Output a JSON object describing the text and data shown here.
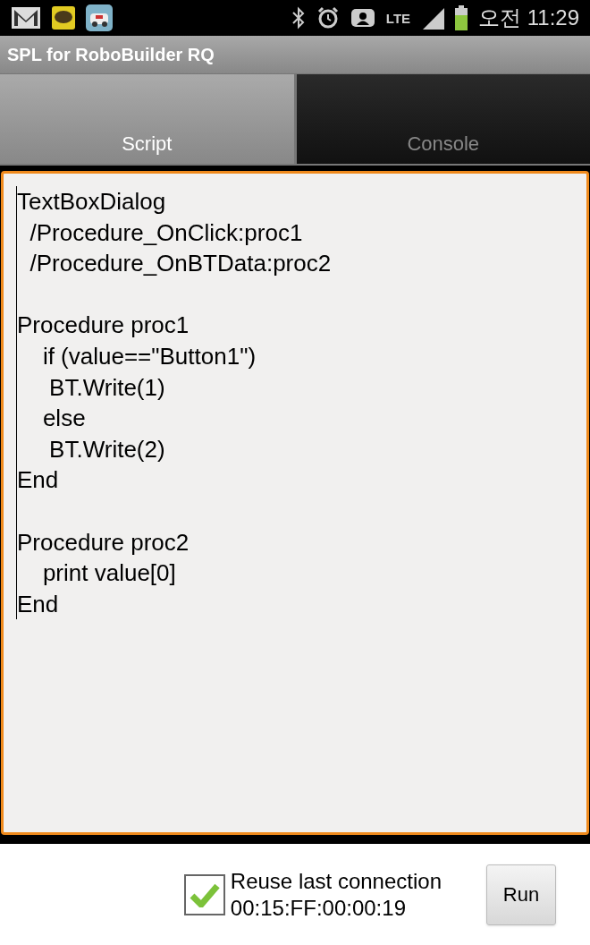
{
  "status_bar": {
    "network": "LTE",
    "time": "오전 11:29"
  },
  "title_bar": {
    "title": "SPL for RoboBuilder RQ"
  },
  "tabs": [
    {
      "label": "Script",
      "selected": true
    },
    {
      "label": "Console",
      "selected": false
    }
  ],
  "editor": {
    "code": "TextBoxDialog\n  /Procedure_OnClick:proc1\n  /Procedure_OnBTData:proc2\n\nProcedure proc1\n    if (value==\"Button1\")\n     BT.Write(1)\n    else\n     BT.Write(2)\nEnd\n\nProcedure proc2\n    print value[0]\nEnd"
  },
  "footer": {
    "checkbox": {
      "label": "Reuse last connection",
      "detail": "00:15:FF:00:00:19",
      "checked": true
    },
    "button": "Run"
  }
}
